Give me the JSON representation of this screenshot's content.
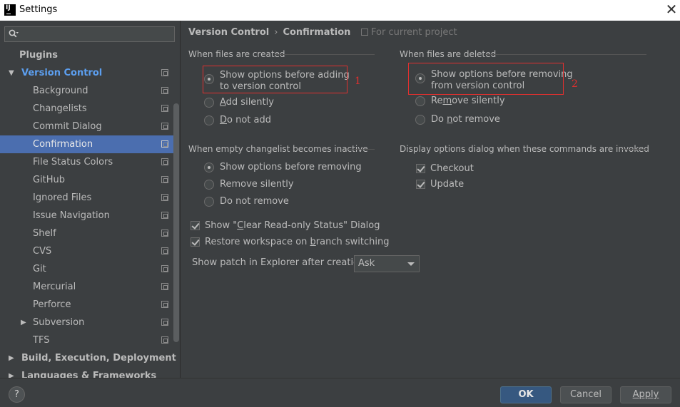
{
  "window": {
    "title": "Settings",
    "app_icon_text": "IJ"
  },
  "sidebar": {
    "search_placeholder": "",
    "items": [
      {
        "label": "Plugins"
      },
      {
        "label": "Version Control"
      },
      {
        "label": "Background"
      },
      {
        "label": "Changelists"
      },
      {
        "label": "Commit Dialog"
      },
      {
        "label": "Confirmation"
      },
      {
        "label": "File Status Colors"
      },
      {
        "label": "GitHub"
      },
      {
        "label": "Ignored Files"
      },
      {
        "label": "Issue Navigation"
      },
      {
        "label": "Shelf"
      },
      {
        "label": "CVS"
      },
      {
        "label": "Git"
      },
      {
        "label": "Mercurial"
      },
      {
        "label": "Perforce"
      },
      {
        "label": "Subversion"
      },
      {
        "label": "TFS"
      },
      {
        "label": "Build, Execution, Deployment"
      },
      {
        "label": "Languages & Frameworks"
      }
    ]
  },
  "breadcrumb": {
    "parent": "Version Control",
    "separator": "›",
    "current": "Confirmation",
    "scope": "For current project"
  },
  "groups": {
    "created": {
      "title": "When files are created",
      "options": [
        "Show options before adding",
        "to version control",
        "Add silently",
        "Do not add"
      ],
      "mnemonic_add": "A",
      "mnemonic_add_rest": "dd silently",
      "mnemonic_donot": "D",
      "mnemonic_donot_rest": "o not add"
    },
    "deleted": {
      "title": "When files are deleted",
      "options": [
        "Show options before removing",
        "from version control",
        "Remove silently",
        "Do not remove"
      ],
      "remove_pre": "Re",
      "remove_u": "m",
      "remove_post": "ove silently",
      "donot_pre": "Do ",
      "donot_u": "n",
      "donot_post": "ot remove"
    },
    "empty_changelist": {
      "title": "When empty changelist becomes inactive",
      "options": [
        "Show options before removing",
        "Remove silently",
        "Do not remove"
      ]
    },
    "display_options": {
      "title": "Display options dialog when these commands are invoked",
      "options": [
        "Checkout",
        "Update"
      ]
    }
  },
  "checkboxes": {
    "clear_readonly_pre": "Show \"",
    "clear_readonly_u": "C",
    "clear_readonly_post": "lear Read-only Status\" Dialog",
    "restore_pre": "Restore workspace on ",
    "restore_u": "b",
    "restore_post": "ranch switching"
  },
  "patch": {
    "label": "Show patch in Explorer after creation:",
    "value": "Ask"
  },
  "annotations": {
    "one": "1",
    "two": "2"
  },
  "footer": {
    "help": "?",
    "ok": "OK",
    "cancel": "Cancel",
    "apply": "Apply"
  },
  "colors": {
    "background": "#3c3f41",
    "selection": "#4b6eaf",
    "accent_link": "#5c9ff0",
    "annotation_red": "#e0302f",
    "primary_button": "#365880"
  }
}
